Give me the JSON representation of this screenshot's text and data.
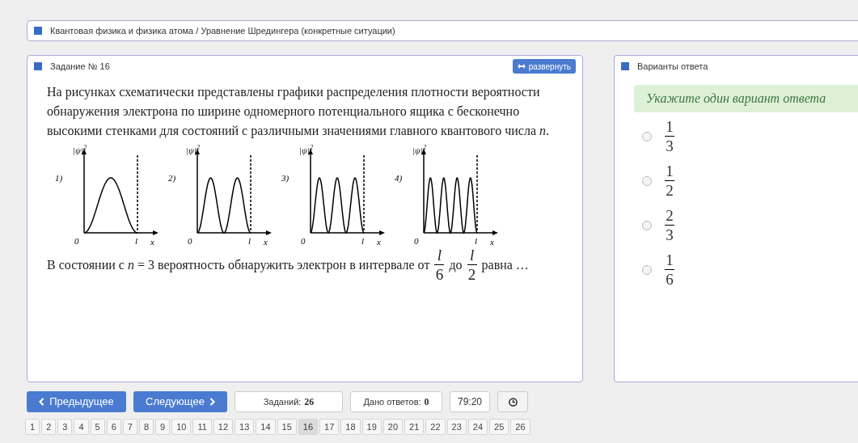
{
  "breadcrumb": "Квантовая физика и физика атома / Уравнение Шредингера (конкретные ситуации)",
  "task": {
    "title": "Задание № 16",
    "expand_button": "развернуть",
    "intro": "На рисунках схематически представлены графики распределения плотности вероятности обнаружения электрона по ширине одномерного потенциального ящика с бесконечно высокими стенками для состояний с различными значениями главного квантового числа *n*.",
    "graphs": [
      {
        "label": "1)",
        "y_axis": "|ψ|",
        "power": "2",
        "origin": "0",
        "width_mark": "l",
        "x_axis": "x"
      },
      {
        "label": "2)",
        "y_axis": "|ψ|",
        "power": "2",
        "origin": "0",
        "width_mark": "l",
        "x_axis": "x"
      },
      {
        "label": "3)",
        "y_axis": "|ψ|",
        "power": "2",
        "origin": "0",
        "width_mark": "l",
        "x_axis": "x"
      },
      {
        "label": "4)",
        "y_axis": "|ψ|",
        "power": "2",
        "origin": "0",
        "width_mark": "l",
        "x_axis": "x"
      }
    ],
    "question": [
      {
        "kind": "text",
        "text": "В состоянии с *n* = 3 вероятность обнаружить электрон в интервале от"
      },
      {
        "kind": "fraction",
        "numerator": "l",
        "denominator": "6"
      },
      {
        "kind": "text",
        "text": "до"
      },
      {
        "kind": "fraction",
        "numerator": "l",
        "denominator": "2"
      },
      {
        "kind": "text",
        "text": "равна …"
      }
    ]
  },
  "answers": {
    "title": "Варианты ответа",
    "hint": "Укажите один вариант ответа",
    "options": [
      {
        "numerator": "1",
        "denominator": "3",
        "selected": false
      },
      {
        "numerator": "1",
        "denominator": "2",
        "selected": false
      },
      {
        "numerator": "2",
        "denominator": "3",
        "selected": false
      },
      {
        "numerator": "1",
        "denominator": "6",
        "selected": false
      }
    ]
  },
  "nav": {
    "prev": "Предыдущее",
    "next": "Следующее",
    "tasks_label": "Заданий:",
    "tasks_count": "26",
    "answered_label": "Дано ответов:",
    "answered_count": "0",
    "timer": "79:20"
  },
  "pages": [
    {
      "label": "1",
      "selected": false
    },
    {
      "label": "2",
      "selected": false
    },
    {
      "label": "3",
      "selected": false
    },
    {
      "label": "4",
      "selected": false
    },
    {
      "label": "5",
      "selected": false
    },
    {
      "label": "6",
      "selected": false
    },
    {
      "label": "7",
      "selected": false
    },
    {
      "label": "8",
      "selected": false
    },
    {
      "label": "9",
      "selected": false
    },
    {
      "label": "10",
      "selected": false
    },
    {
      "label": "11",
      "selected": false
    },
    {
      "label": "12",
      "selected": false
    },
    {
      "label": "13",
      "selected": false
    },
    {
      "label": "14",
      "selected": false
    },
    {
      "label": "15",
      "selected": false
    },
    {
      "label": "16",
      "selected": true
    },
    {
      "label": "17",
      "selected": false
    },
    {
      "label": "18",
      "selected": false
    },
    {
      "label": "19",
      "selected": false
    },
    {
      "label": "20",
      "selected": false
    },
    {
      "label": "21",
      "selected": false
    },
    {
      "label": "22",
      "selected": false
    },
    {
      "label": "23",
      "selected": false
    },
    {
      "label": "24",
      "selected": false
    },
    {
      "label": "25",
      "selected": false
    },
    {
      "label": "26",
      "selected": false
    }
  ]
}
